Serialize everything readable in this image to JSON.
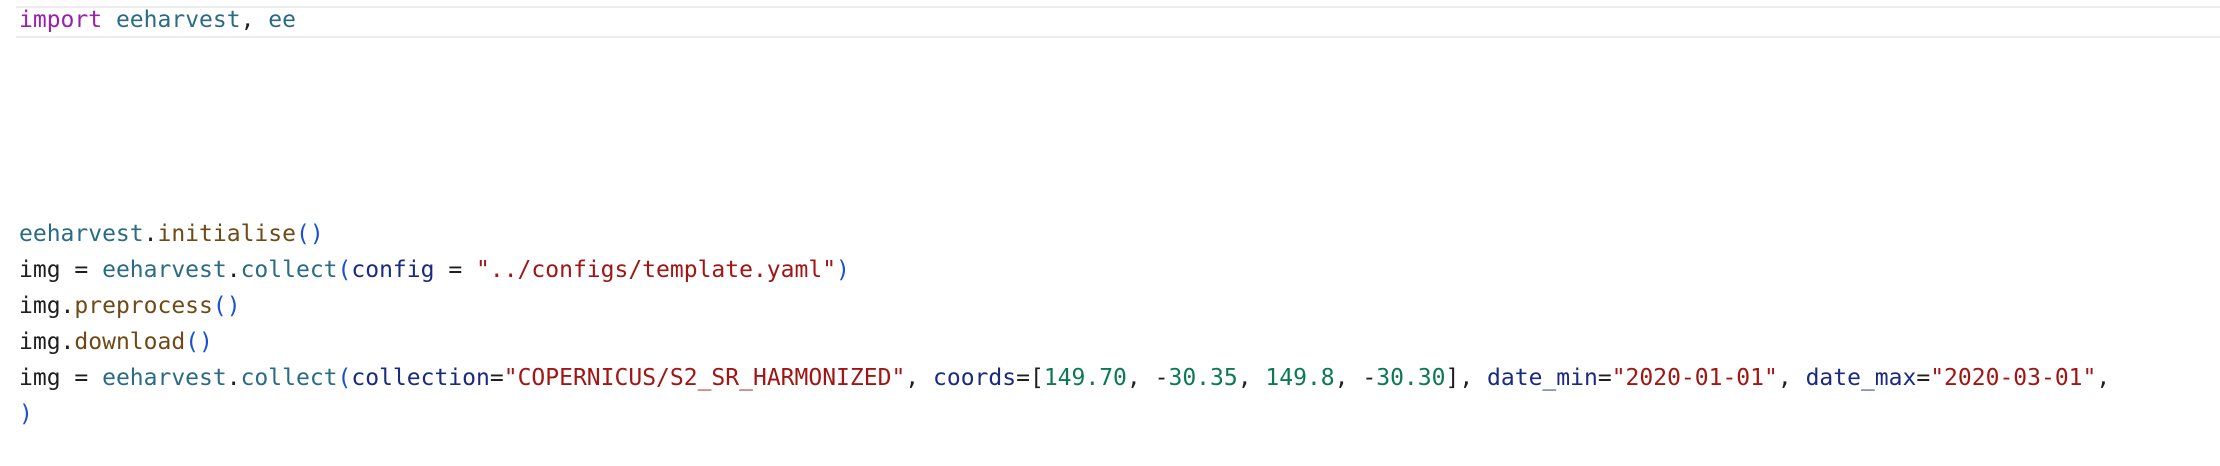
{
  "code": {
    "line0": {
      "kw": "import",
      "mod1": "eeharvest",
      "sep": ", ",
      "mod2": "ee"
    },
    "line1": {
      "mod": "eeharvest",
      "dot": ".",
      "fn": "initialise",
      "paren": "()"
    },
    "line2": {
      "var": "img",
      "eq": " = ",
      "mod": "eeharvest",
      "dot": ".",
      "fn": "collect",
      "lparen": "(",
      "param": "config",
      "eq2": " = ",
      "str": "\"../configs/template.yaml\"",
      "rparen": ")"
    },
    "line3": {
      "var": "img",
      "dot": ".",
      "fn": "preprocess",
      "paren": "()"
    },
    "line4": {
      "var": "img",
      "dot": ".",
      "fn": "download",
      "paren": "()"
    },
    "line5": {
      "var": "img",
      "eq": " = ",
      "mod": "eeharvest",
      "dot": ".",
      "fn": "collect",
      "lparen": "(",
      "p1": "collection",
      "eqA": "=",
      "s1": "\"COPERNICUS/S2_SR_HARMONIZED\"",
      "c1": ", ",
      "p2": "coords",
      "eqB": "=",
      "lbr": "[",
      "n1": "149.70",
      "c2": ", ",
      "neg1": "-",
      "n2": "30.35",
      "c3": ", ",
      "n3": "149.8",
      "c4": ", ",
      "neg2": "-",
      "n4": "30.30",
      "rbr": "]",
      "c5": ", ",
      "p3": "date_min",
      "eqC": "=",
      "s2": "\"2020-01-01\"",
      "c6": ", ",
      "p4": "date_max",
      "eqD": "=",
      "s3": "\"2020-03-01\"",
      "c7": ","
    },
    "line6": {
      "rparen": ")"
    }
  }
}
